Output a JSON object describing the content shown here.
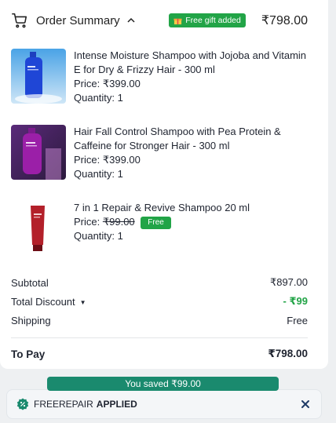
{
  "header": {
    "title": "Order Summary",
    "gift_badge": "Free gift added",
    "total": "₹798.00"
  },
  "items": [
    {
      "name": "Intense Moisture Shampoo with Jojoba and Vitamin E for Dry & Frizzy Hair - 300 ml",
      "price": "Price: ₹399.00",
      "quantity": "Quantity: 1"
    },
    {
      "name": "Hair Fall Control Shampoo with Pea Protein & Caffeine for Stronger Hair - 300 ml",
      "price": "Price: ₹399.00",
      "quantity": "Quantity: 1"
    },
    {
      "name": "7 in 1 Repair & Revive Shampoo 20 ml",
      "price_label": "Price:",
      "price_struck": "₹99.00",
      "free_tag": "Free",
      "quantity": "Quantity: 1"
    }
  ],
  "summary": {
    "subtotal_label": "Subtotal",
    "subtotal_value": "₹897.00",
    "discount_label": "Total Discount",
    "discount_value": "- ₹99",
    "shipping_label": "Shipping",
    "shipping_value": "Free",
    "topay_label": "To Pay",
    "topay_value": "₹798.00"
  },
  "savings": {
    "text": "You saved ₹99.00"
  },
  "coupon": {
    "code": "FREEREPAIR",
    "status": "APPLIED"
  },
  "colors": {
    "green": "#22a447",
    "teal": "#1a8a6e"
  }
}
